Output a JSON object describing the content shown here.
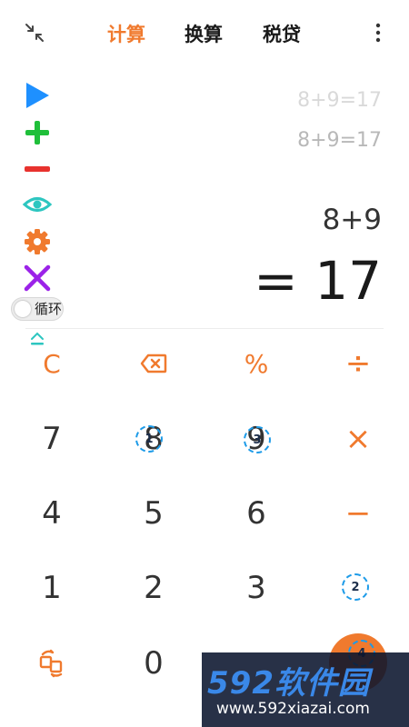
{
  "tabs": [
    {
      "label": "计算",
      "active": true
    },
    {
      "label": "换算",
      "active": false
    },
    {
      "label": "税贷",
      "active": false
    }
  ],
  "icons": {
    "shrink": "collapse-arrows-icon",
    "more": "more-vertical-icon",
    "play": "play-icon",
    "add": "plus-icon",
    "remove": "minus-icon",
    "eye": "eye-icon",
    "settings": "gear-icon",
    "close": "close-icon",
    "collapse": "chevron-up-icon",
    "swap": "swap-icon",
    "backspace": "backspace-icon"
  },
  "loop": {
    "label": "循环",
    "on": false
  },
  "history": [
    "8+9=17",
    "8+9=17"
  ],
  "display": {
    "expression": "8+9",
    "result": "= 17"
  },
  "keypad": {
    "clear": "C",
    "percent": "%",
    "divide": "÷",
    "multiply": "×",
    "minus": "−",
    "digits": [
      "0",
      "1",
      "2",
      "3",
      "4",
      "5",
      "6",
      "7",
      "8",
      "9"
    ]
  },
  "markers": [
    "1",
    "3",
    "2",
    "4"
  ],
  "colors": {
    "accent": "#f07a2e",
    "marker": "#1d9be8",
    "play": "#1e90ff",
    "add": "#1fbf3a",
    "remove": "#e8322e",
    "eye": "#2dc6c0",
    "close": "#9b22e8"
  },
  "watermark": {
    "logo": "592软件园",
    "url": "www.592xiazai.com"
  }
}
